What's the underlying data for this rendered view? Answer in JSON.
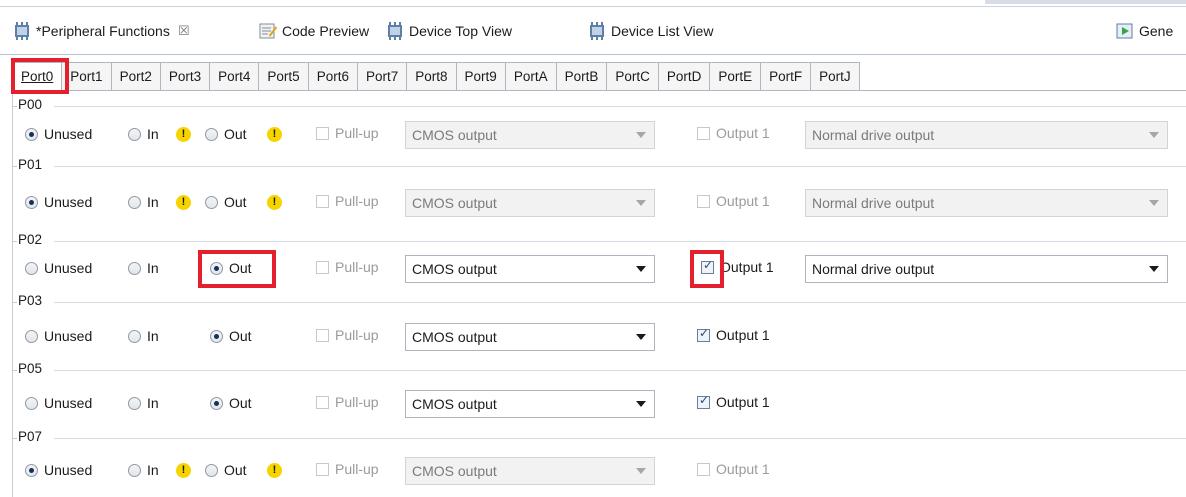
{
  "editor_tabs": [
    {
      "label": "*Peripheral Functions",
      "close": "☒"
    },
    {
      "label": "Code Preview"
    },
    {
      "label": "Device Top View"
    },
    {
      "label": "Device List View"
    },
    {
      "label": "Gene"
    }
  ],
  "port_tabs": [
    "Port0",
    "Port1",
    "Port2",
    "Port3",
    "Port4",
    "Port5",
    "Port6",
    "Port7",
    "Port8",
    "Port9",
    "PortA",
    "PortB",
    "PortC",
    "PortD",
    "PortE",
    "PortF",
    "PortJ"
  ],
  "labels": {
    "unused": "Unused",
    "in": "In",
    "out": "Out",
    "pullup": "Pull-up",
    "output1": "Output 1",
    "warn": "!"
  },
  "groups": [
    {
      "name": "P00",
      "mode": "Unused",
      "pullup": false,
      "output_type": "CMOS output",
      "output1": false,
      "drive": "Normal drive output",
      "enabled": false
    },
    {
      "name": "P01",
      "mode": "Unused",
      "pullup": false,
      "output_type": "CMOS output",
      "output1": false,
      "drive": "Normal drive output",
      "enabled": false
    },
    {
      "name": "P02",
      "mode": "Out",
      "pullup": false,
      "output_type": "CMOS output",
      "output1": true,
      "drive": "Normal drive output",
      "enabled": true
    },
    {
      "name": "P03",
      "mode": "Out",
      "pullup": false,
      "output_type": "CMOS output",
      "output1": true,
      "enabled": true
    },
    {
      "name": "P05",
      "mode": "Out",
      "pullup": false,
      "output_type": "CMOS output",
      "output1": true,
      "enabled": true
    },
    {
      "name": "P07",
      "mode": "Unused",
      "pullup": false,
      "output_type": "CMOS output",
      "output1": false,
      "enabled": false
    }
  ],
  "colors": {
    "highlight": "#e5202e",
    "warning": "#f5d400"
  }
}
